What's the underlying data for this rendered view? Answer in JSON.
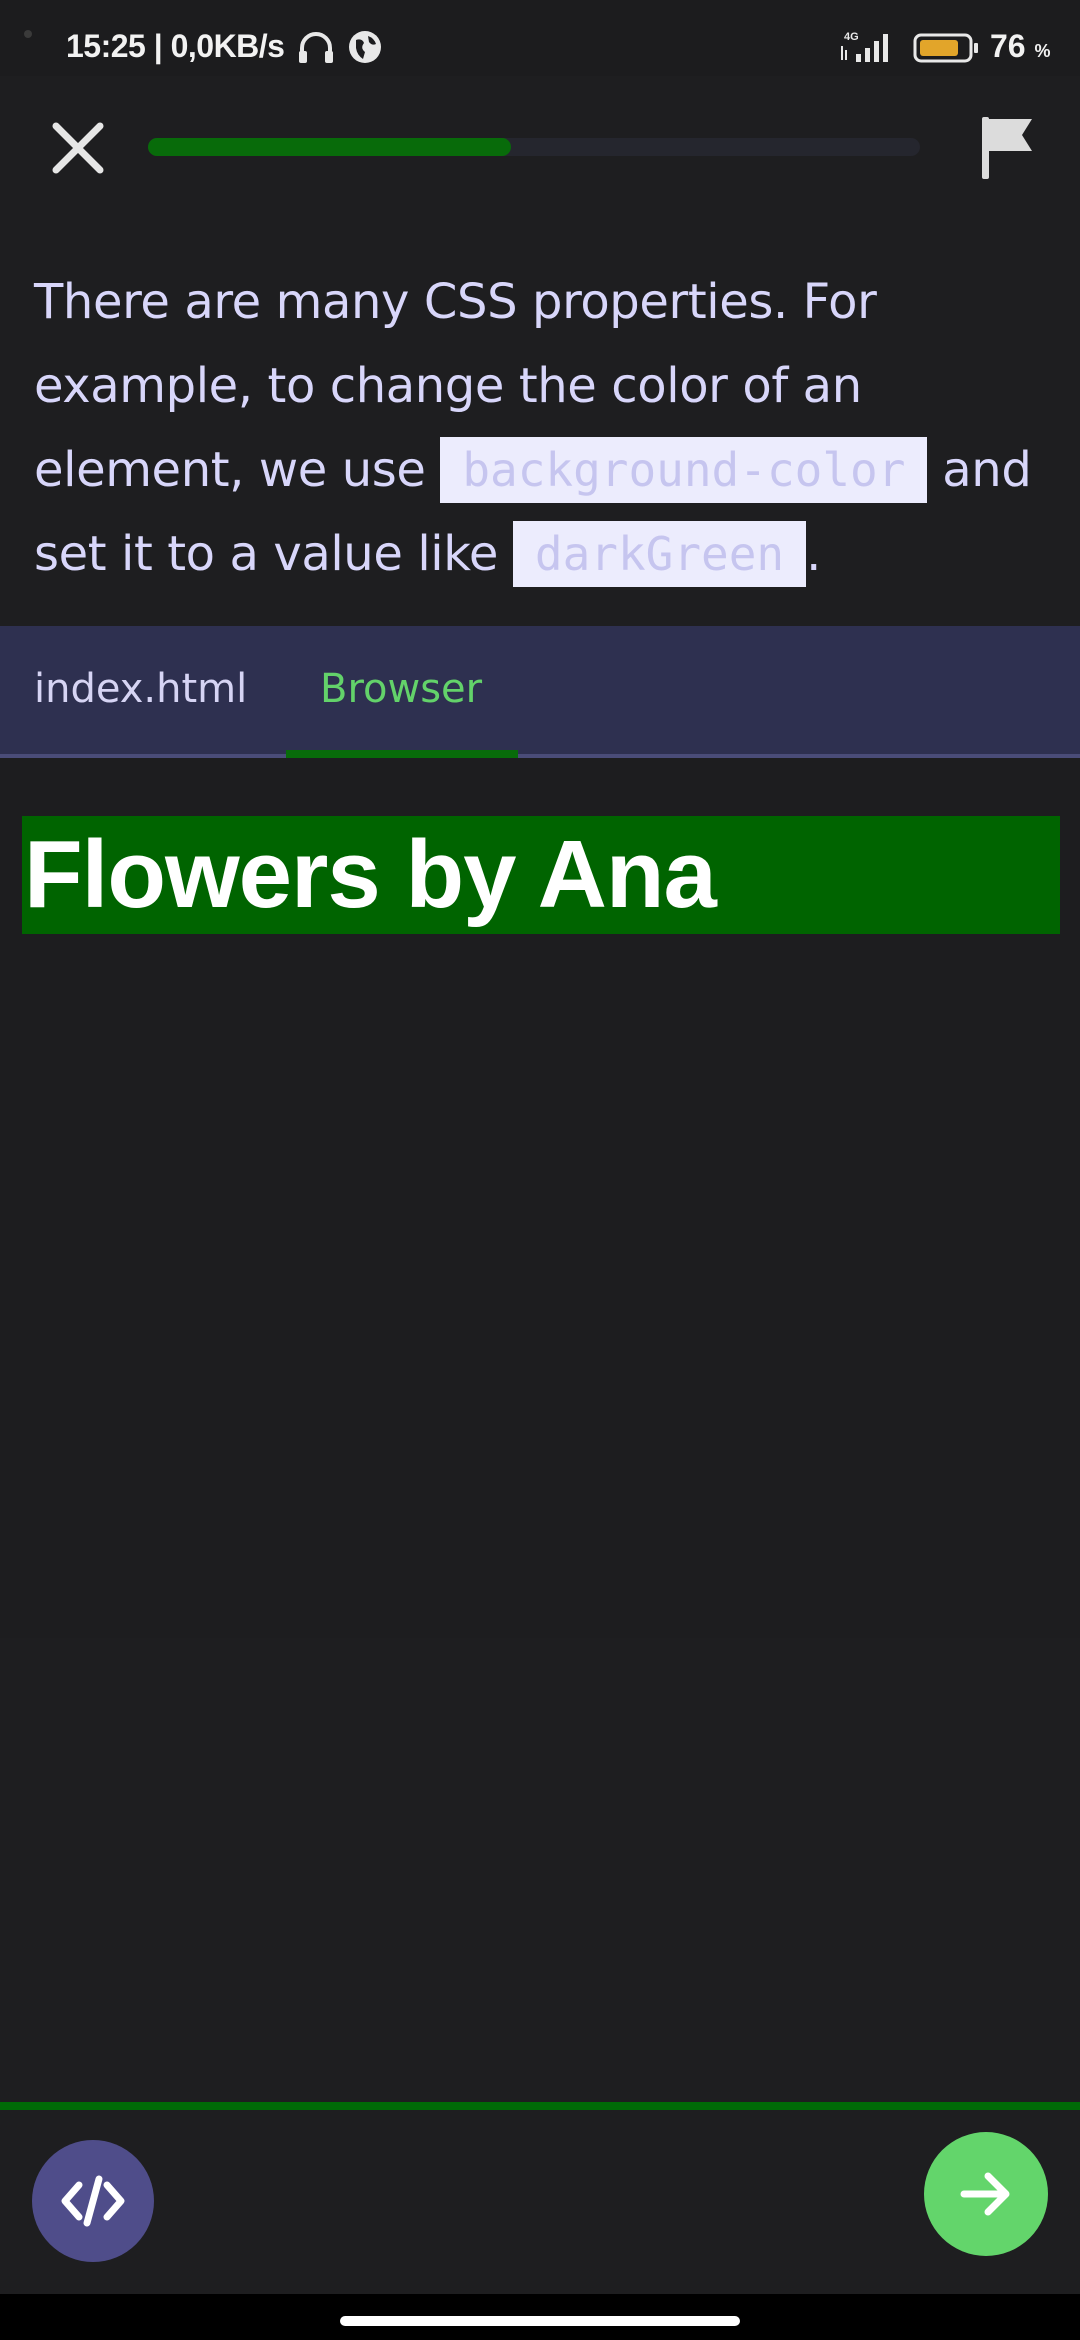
{
  "status_bar": {
    "time": "15:25 | 0,0KB/s",
    "network": "4G",
    "battery_percent": "76",
    "battery_unit": "%",
    "icons": [
      "headset-icon",
      "globe-icon",
      "signal-icon",
      "battery-icon"
    ]
  },
  "lesson": {
    "progress_percent": 47,
    "close_icon": "close-icon",
    "flag_icon": "flag-icon"
  },
  "instruction": {
    "part1": "There are many CSS properties. For example, to change the color of an element, we use ",
    "code1": "background-color",
    "part2": " and set it to a value like ",
    "code2": "darkGreen",
    "part3": "."
  },
  "tabs": [
    {
      "label": "index.html",
      "active": false
    },
    {
      "label": "Browser",
      "active": true
    }
  ],
  "preview": {
    "heading": "Flowers by Ana",
    "heading_bg": "#006400"
  },
  "bottom": {
    "code_icon": "code-icon",
    "next_icon": "arrow-right-icon"
  },
  "colors": {
    "accent_green": "#63d56b",
    "dark_green": "#006400",
    "tabbar": "#2e3050",
    "text_lavender": "#d8d6fa"
  }
}
